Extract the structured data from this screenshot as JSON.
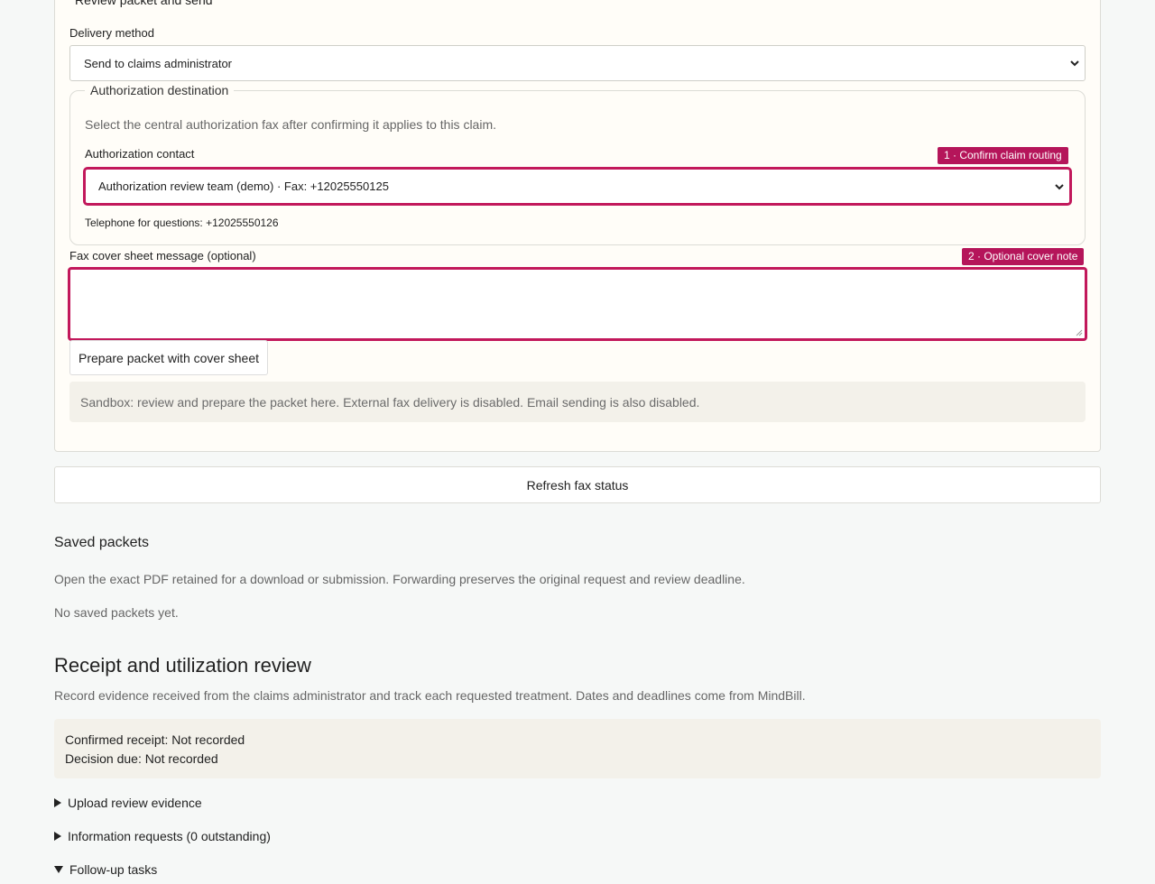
{
  "review_section": {
    "legend": "Review packet and send",
    "delivery_method_label": "Delivery method",
    "delivery_method_value": "Send to claims administrator",
    "auth_destination": {
      "legend": "Authorization destination",
      "instruction": "Select the central authorization fax after confirming it applies to this claim.",
      "contact_label": "Authorization contact",
      "contact_value": "Authorization review team (demo) · Fax: +12025550125",
      "telephone": "Telephone for questions: +12025550126",
      "badge": "1 · Confirm claim routing"
    },
    "cover_message_label": "Fax cover sheet message (optional)",
    "cover_message_value": "",
    "cover_badge": "2 · Optional cover note",
    "prepare_button": "Prepare packet with cover sheet",
    "sandbox_notice": "Sandbox: review and prepare the packet here. External fax delivery is disabled. Email sending is also disabled."
  },
  "refresh_button": "Refresh fax status",
  "saved_packets": {
    "heading": "Saved packets",
    "description": "Open the exact PDF retained for a download or submission. Forwarding preserves the original request and review deadline.",
    "empty": "No saved packets yet."
  },
  "receipt_review": {
    "heading": "Receipt and utilization review",
    "description": "Record evidence received from the claims administrator and track each requested treatment. Dates and deadlines come from MindBill.",
    "confirmed_receipt": "Confirmed receipt: Not recorded",
    "decision_due": "Decision due: Not recorded",
    "details": [
      {
        "label": "Upload review evidence",
        "open": false
      },
      {
        "label": "Information requests (0 outstanding)",
        "open": false
      },
      {
        "label": "Follow-up tasks",
        "open": true
      }
    ]
  },
  "colors": {
    "accent": "#c2185b",
    "badge": "#b5155a",
    "notice_bg": "#f3f1ea"
  },
  "icons": [
    "chevron-down-icon",
    "resize-handle-icon",
    "disclosure-triangle-icon"
  ]
}
